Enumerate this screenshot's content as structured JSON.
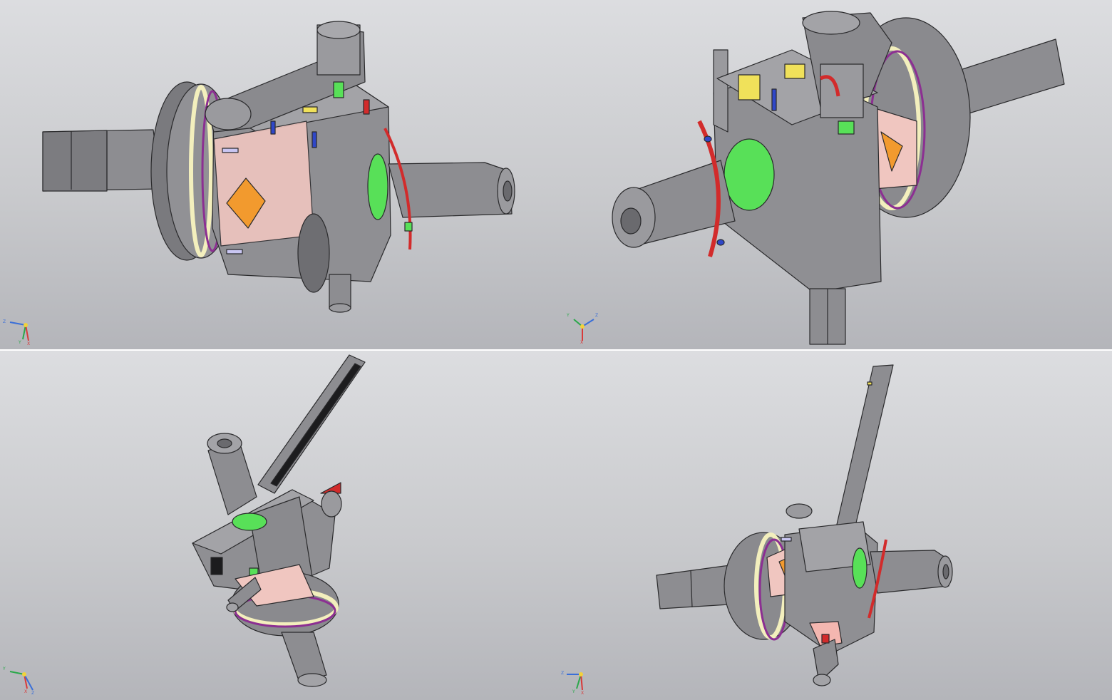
{
  "viewports": [
    {
      "axes": {
        "labels": [
          "Z",
          "Y",
          "X"
        ],
        "colors": [
          "#3a6fd8",
          "#2aa84a",
          "#d83a3a"
        ]
      }
    },
    {
      "axes": {
        "labels": [
          "Y",
          "Z",
          "X"
        ],
        "colors": [
          "#2aa84a",
          "#3a6fd8",
          "#d83a3a"
        ]
      }
    },
    {
      "axes": {
        "labels": [
          "Y",
          "X",
          "Z"
        ],
        "colors": [
          "#2aa84a",
          "#d83a3a",
          "#3a6fd8"
        ]
      }
    },
    {
      "axes": {
        "labels": [
          "Z",
          "Y",
          "X"
        ],
        "colors": [
          "#3a6fd8",
          "#2aa84a",
          "#d83a3a"
        ]
      }
    }
  ],
  "colors": {
    "body": "#8f8f93",
    "body_dark": "#6a6a6e",
    "edge": "#2a2a2c",
    "ring_cream": "#f3efbd",
    "ring_purple": "#8c2f92",
    "green": "#58e058",
    "red": "#d22b2b",
    "yellow": "#f0e15a",
    "blue": "#2f47c8",
    "orange": "#f29a2e",
    "pink": "#f4b7b0",
    "lavender": "#c9c6f2"
  }
}
